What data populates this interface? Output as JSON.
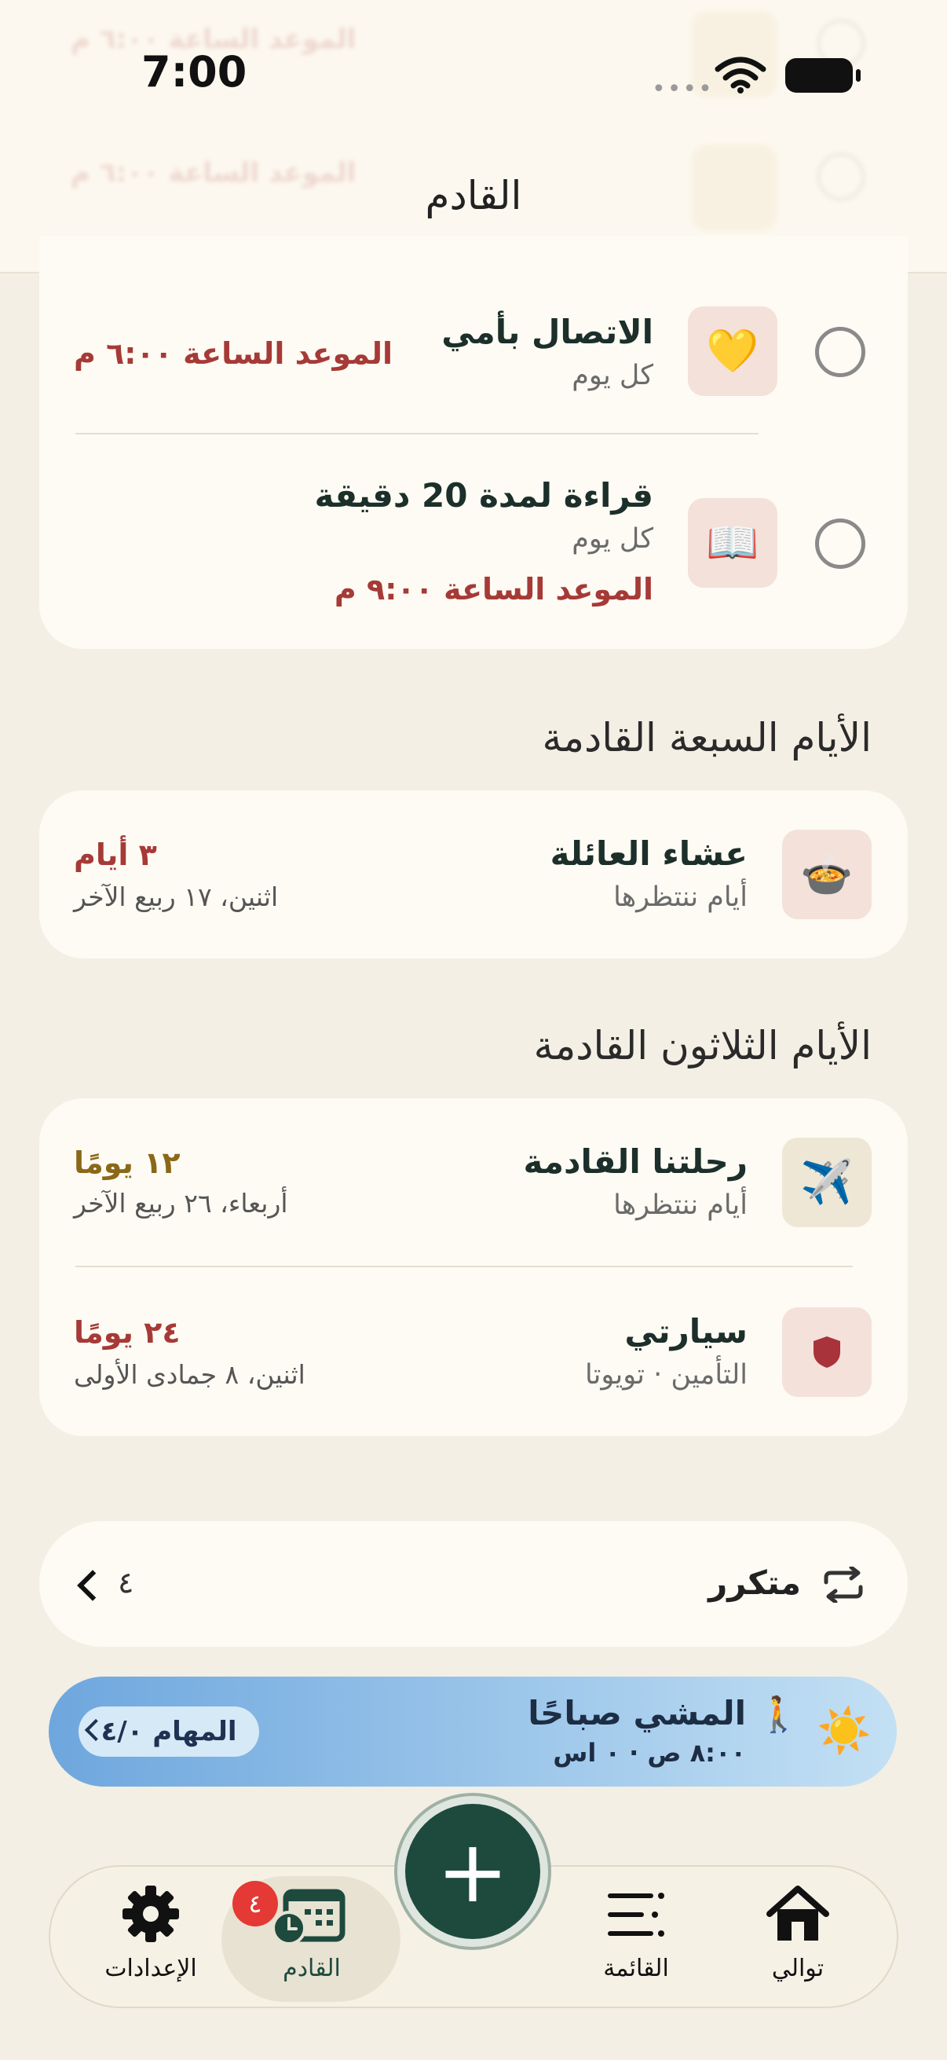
{
  "status_bar": {
    "time": "7:00"
  },
  "header": {
    "title": "القادم",
    "ghost_rows": [
      {
        "title": "",
        "due": "الموعد الساعة ٦:٠٠ م"
      },
      {
        "title": "",
        "due": "الموعد الساعة ٦:٠٠ م"
      }
    ]
  },
  "today_tasks": [
    {
      "title": "الاتصال بأمي",
      "subtitle": "كل يوم",
      "due": "الموعد الساعة ٦:٠٠ م",
      "icon": "yellow-heart-icon",
      "icon_glyph": "💛"
    },
    {
      "title": "قراءة لمدة 20 دقيقة",
      "subtitle": "كل يوم",
      "due": "الموعد الساعة ٩:٠٠ م",
      "icon": "open-book-icon",
      "icon_glyph": "📖"
    }
  ],
  "next_seven_days": {
    "heading": "الأيام السبعة القادمة",
    "items": [
      {
        "title": "عشاء العائلة",
        "subtitle": "أيام ننتظرها",
        "countdown": "٣ أيام",
        "date": "اثنين، ١٧ ربيع الآخر",
        "icon": "soup-bowl-icon",
        "icon_glyph": "🍲"
      }
    ]
  },
  "next_thirty_days": {
    "heading": "الأيام الثلاثون القادمة",
    "items": [
      {
        "title": "رحلتنا القادمة",
        "subtitle": "أيام ننتظرها",
        "countdown": "١٢ يومًا",
        "date": "أربعاء، ٢٦ ربيع الآخر",
        "icon": "airplane-icon",
        "icon_glyph": "✈️"
      },
      {
        "title": "سيارتي",
        "subtitle": "التأمين · تويوتا",
        "countdown": "٢٤ يومًا",
        "date": "اثنين، ٨ جمادى الأولى",
        "icon": "shield-icon",
        "icon_glyph": ""
      }
    ]
  },
  "recurring": {
    "label": "متكرر",
    "count": "٤"
  },
  "morning_banner": {
    "title": "المشي صباحًا",
    "time": "٨:٠٠ ص · ٠ اس",
    "tasks_pill": "المهام ٤/٠"
  },
  "tab_bar": {
    "tabs": [
      {
        "label": "توالي",
        "icon": "home-icon"
      },
      {
        "label": "القائمة",
        "icon": "list-icon"
      },
      {
        "label": "القادم",
        "icon": "calendar-clock-icon"
      },
      {
        "label": "الإعدادات",
        "icon": "gear-icon"
      }
    ],
    "upcoming_badge": "٤",
    "active_tab": "القادم",
    "add_label": "+"
  },
  "colors": {
    "background": "#f3efe4",
    "card": "#fdfbf4",
    "due_red": "#a63a36",
    "due_olive": "#8a6818",
    "accent_green": "#1e4a3e",
    "badge_red": "#e53935"
  }
}
